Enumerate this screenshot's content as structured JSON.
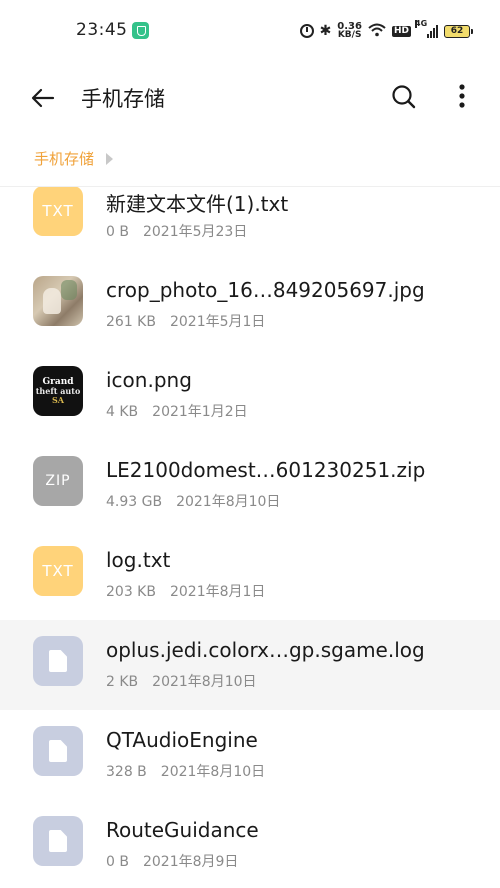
{
  "status_bar": {
    "time": "23:45",
    "speed_value": "0.36",
    "speed_unit": "KB/S",
    "hd": "HD",
    "network": "4G",
    "battery": "62"
  },
  "app_bar": {
    "title": "手机存储"
  },
  "breadcrumb": {
    "items": [
      "手机存储"
    ]
  },
  "files": [
    {
      "name": "新建文本文件(1).txt",
      "size": "0 B",
      "date": "2021年5月23日",
      "icon": "txt-icon",
      "badge": "TXT"
    },
    {
      "name": "crop_photo_16…849205697.jpg",
      "size": "261 KB",
      "date": "2021年5月1日",
      "icon": "photo-thumbnail",
      "badge": ""
    },
    {
      "name": "icon.png",
      "size": "4 KB",
      "date": "2021年1月2日",
      "icon": "gta-thumbnail",
      "badge": ""
    },
    {
      "name": "LE2100domest…601230251.zip",
      "size": "4.93 GB",
      "date": "2021年8月10日",
      "icon": "zip-icon",
      "badge": "ZIP"
    },
    {
      "name": "log.txt",
      "size": "203 KB",
      "date": "2021年8月1日",
      "icon": "txt-icon",
      "badge": "TXT"
    },
    {
      "name": "oplus.jedi.colorx…gp.sgame.log",
      "size": "2 KB",
      "date": "2021年8月10日",
      "icon": "document-icon",
      "badge": ""
    },
    {
      "name": "QTAudioEngine",
      "size": "328 B",
      "date": "2021年8月10日",
      "icon": "document-icon",
      "badge": ""
    },
    {
      "name": "RouteGuidance",
      "size": "0 B",
      "date": "2021年8月9日",
      "icon": "document-icon",
      "badge": ""
    }
  ],
  "colors": {
    "accent_breadcrumb": "#f0a23a",
    "txt_icon": "#ffd37a",
    "zip_icon": "#a7a7a7",
    "doc_icon": "#c8cee0"
  }
}
